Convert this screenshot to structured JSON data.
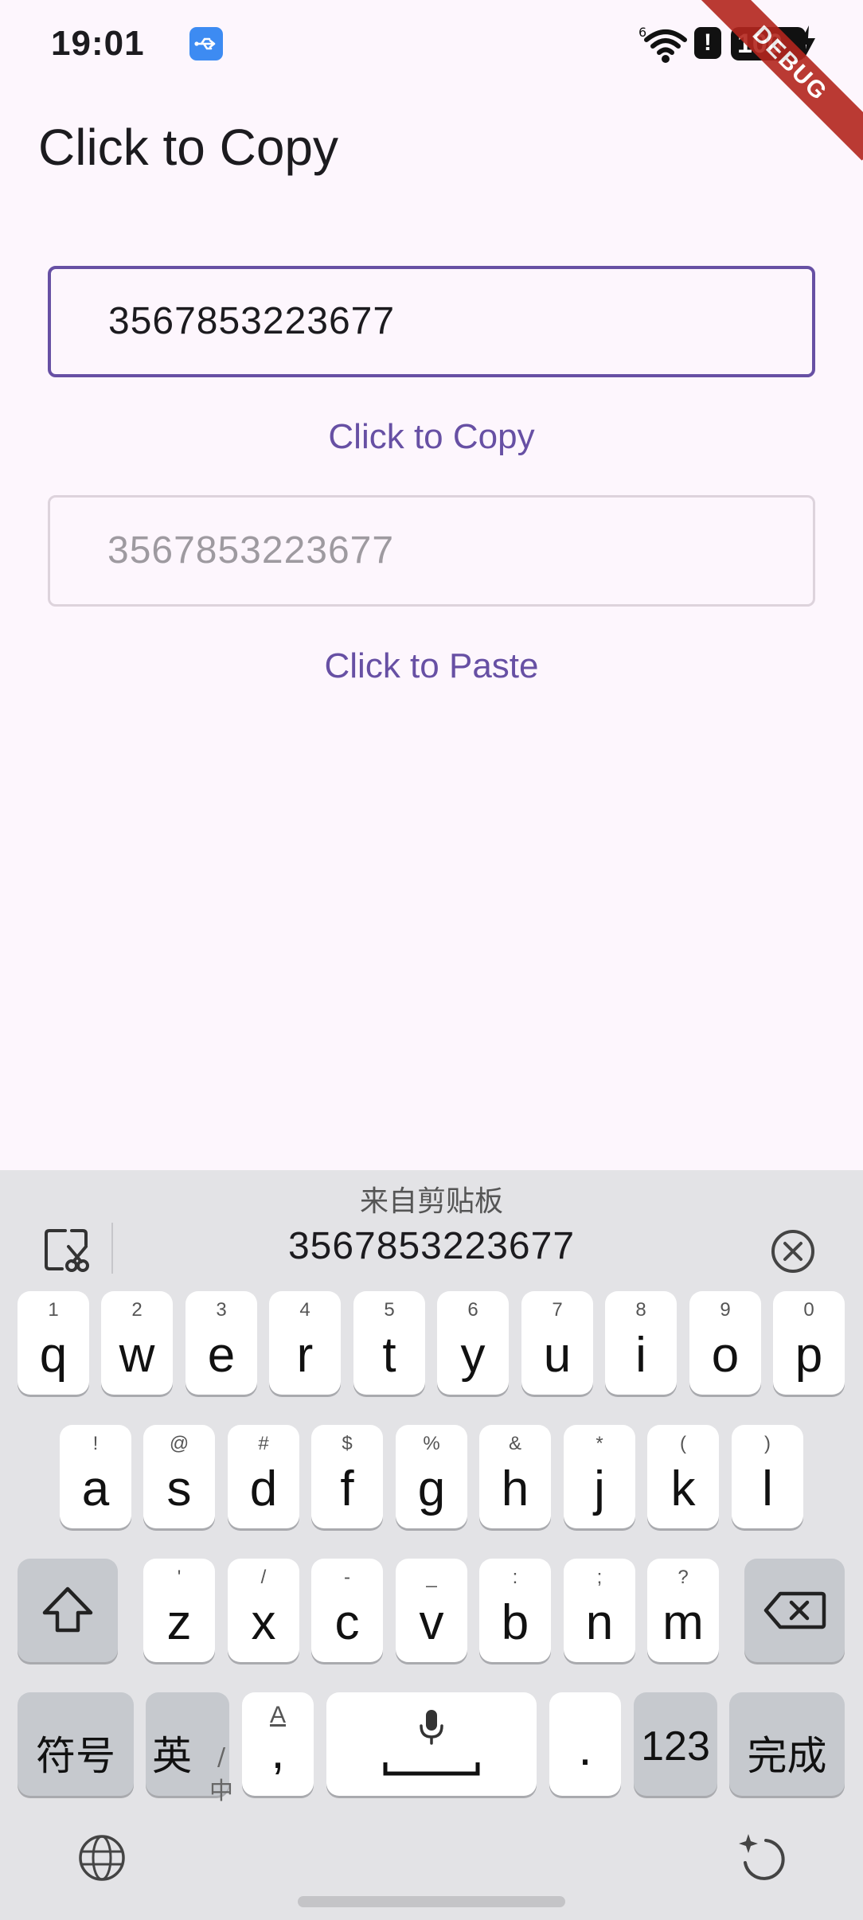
{
  "status_bar": {
    "time": "19:01",
    "battery": "100",
    "debug_label": "DEBUG",
    "icons": [
      "usb-icon",
      "wifi-icon",
      "alert-icon",
      "battery-icon",
      "charging-bolt-icon"
    ]
  },
  "app": {
    "title": "Click to Copy",
    "copy_field_value": "3567853223677",
    "copy_button_label": "Click to Copy",
    "paste_field_value": "3567853223677",
    "paste_button_label": "Click to Paste",
    "accent_color": "#6750a4"
  },
  "keyboard": {
    "clipboard_header": "来自剪贴板",
    "clipboard_item": "3567853223677",
    "row1": [
      {
        "main": "q",
        "sub": "1"
      },
      {
        "main": "w",
        "sub": "2"
      },
      {
        "main": "e",
        "sub": "3"
      },
      {
        "main": "r",
        "sub": "4"
      },
      {
        "main": "t",
        "sub": "5"
      },
      {
        "main": "y",
        "sub": "6"
      },
      {
        "main": "u",
        "sub": "7"
      },
      {
        "main": "i",
        "sub": "8"
      },
      {
        "main": "o",
        "sub": "9"
      },
      {
        "main": "p",
        "sub": "0"
      }
    ],
    "row2": [
      {
        "main": "a",
        "sub": "!"
      },
      {
        "main": "s",
        "sub": "@"
      },
      {
        "main": "d",
        "sub": "#"
      },
      {
        "main": "f",
        "sub": "$"
      },
      {
        "main": "g",
        "sub": "%"
      },
      {
        "main": "h",
        "sub": "&"
      },
      {
        "main": "j",
        "sub": "*"
      },
      {
        "main": "k",
        "sub": "("
      },
      {
        "main": "l",
        "sub": ")"
      }
    ],
    "row3": [
      {
        "main": "z",
        "sub": "'"
      },
      {
        "main": "x",
        "sub": "/"
      },
      {
        "main": "c",
        "sub": "-"
      },
      {
        "main": "v",
        "sub": "_"
      },
      {
        "main": "b",
        "sub": ":"
      },
      {
        "main": "n",
        "sub": ";"
      },
      {
        "main": "m",
        "sub": "?"
      }
    ],
    "symbols_key": "符号",
    "lang_key_main": "英",
    "lang_key_alt": "/中",
    "comma_key": ",",
    "comma_key_sub": "A",
    "period_key": ".",
    "numbers_key": "123",
    "done_key": "完成"
  }
}
